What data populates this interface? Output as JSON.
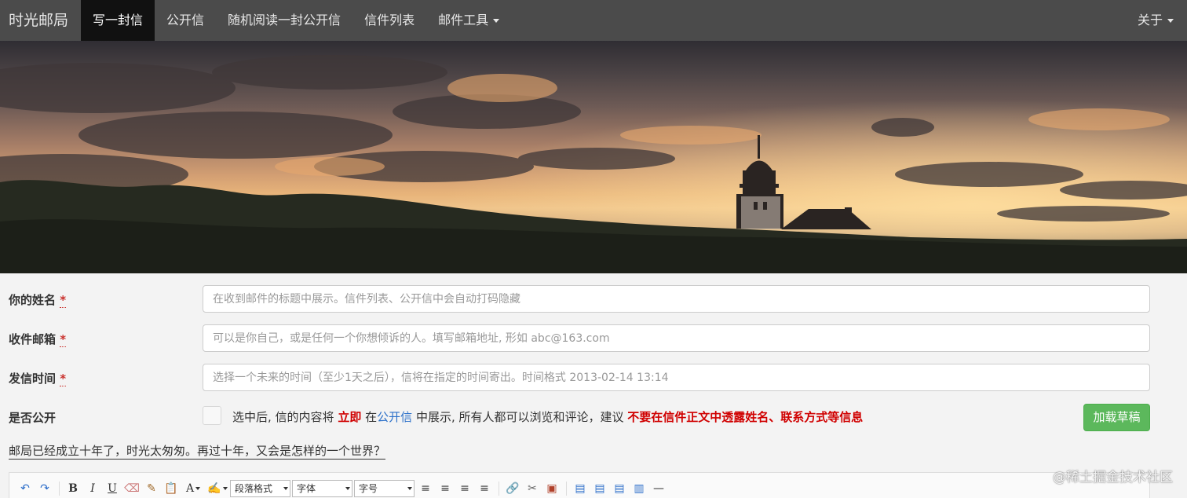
{
  "navbar": {
    "brand": "时光邮局",
    "items": [
      {
        "label": "写一封信"
      },
      {
        "label": "公开信"
      },
      {
        "label": "随机阅读一封公开信"
      },
      {
        "label": "信件列表"
      },
      {
        "label": "邮件工具"
      }
    ],
    "right_label": "关于"
  },
  "form": {
    "name": {
      "label": "你的姓名",
      "required_mark": "*",
      "placeholder": "在收到邮件的标题中展示。信件列表、公开信中会自动打码隐藏"
    },
    "email": {
      "label": "收件邮箱",
      "required_mark": "*",
      "placeholder": "可以是你自己，或是任何一个你想倾诉的人。填写邮箱地址, 形如 abc@163.com"
    },
    "send_time": {
      "label": "发信时间",
      "required_mark": "*",
      "placeholder": "选择一个未来的时间（至少1天之后），信将在指定的时间寄出。时间格式 2013-02-14 13:14"
    },
    "public": {
      "label": "是否公开",
      "text_1": "选中后, 信的内容将",
      "text_immediate": "立即",
      "text_2": "在",
      "text_link": "公开信",
      "text_3": "中展示, 所有人都可以浏览和评论，建议",
      "text_warning": "不要在信件正文中透露姓名、联系方式等信息"
    },
    "load_draft_button": "加载草稿",
    "quote": "邮局已经成立十年了，时光太匆匆。再过十年，又会是怎样的一个世界？"
  },
  "editor_toolbar": {
    "paragraph_format": "段落格式",
    "font_family": "字体",
    "font_size": "字号",
    "bold": "B",
    "italic": "I",
    "underline": "U",
    "font_color": "A"
  },
  "watermark": "@稀土掘金技术社区"
}
